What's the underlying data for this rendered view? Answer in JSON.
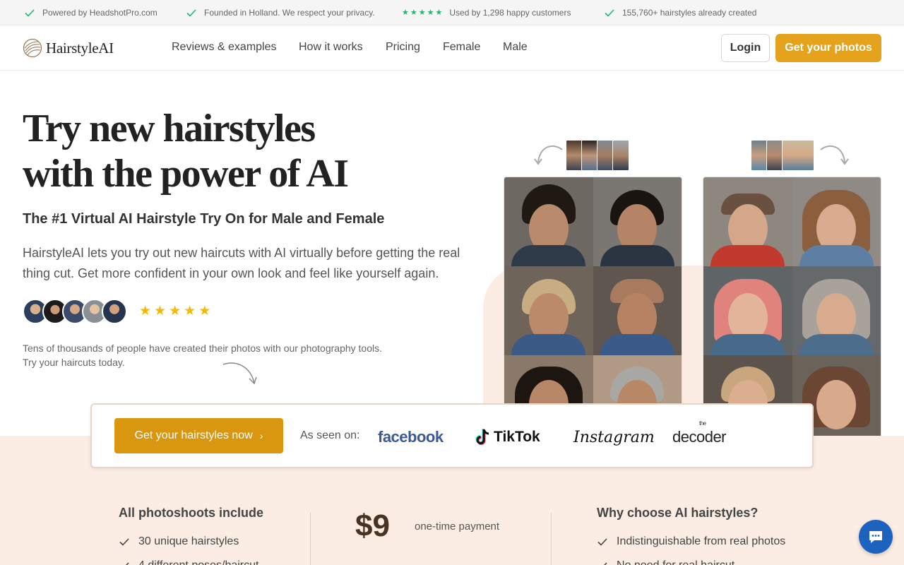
{
  "topbar": {
    "items": [
      {
        "text": "Powered by HeadshotPro.com"
      },
      {
        "text": "Founded in Holland. We respect your privacy."
      },
      {
        "text": "Used by 1,298 happy customers"
      },
      {
        "text": "155,760+ hairstyles already created"
      }
    ]
  },
  "nav": {
    "logo_text": "HairstyleAI",
    "links": [
      "Reviews & examples",
      "How it works",
      "Pricing",
      "Female",
      "Male"
    ],
    "login_label": "Login",
    "get_photos_label": "Get your photos"
  },
  "hero": {
    "title_line1": "Try new hairstyles",
    "title_line2": "with the power of AI",
    "subtitle": "The #1 Virtual AI Hairstyle Try On for Male and Female",
    "description": "HairstyleAI lets you try out new haircuts with AI virtually before getting the real thing cut. Get more confident in your own look and feel like yourself again.",
    "rating_stars": 5,
    "trust_line1": "Tens of thousands of people have created their photos with our photography tools.",
    "trust_line2": "Try your haircuts today."
  },
  "action": {
    "cta_label": "Get your hairstyles now",
    "seen_on_label": "As seen on:",
    "brands": [
      "facebook",
      "TikTok",
      "Instagram",
      "decoder"
    ],
    "decoder_prefix": "the"
  },
  "info": {
    "left_heading": "All photoshoots include",
    "left_items": [
      "30 unique hairstyles",
      "4 different poses/haircut"
    ],
    "price": "$9",
    "price_note": "one-time payment",
    "right_heading": "Why choose AI hairstyles?",
    "right_items": [
      "Indistinguishable from real photos",
      "No need for real haircut"
    ]
  },
  "colors": {
    "accent": "#e4a21d",
    "cta": "#d9960f",
    "check_green": "#22b573",
    "star_yellow": "#f5b90b",
    "peach": "#fbede3",
    "chat_blue": "#1e62c0"
  }
}
